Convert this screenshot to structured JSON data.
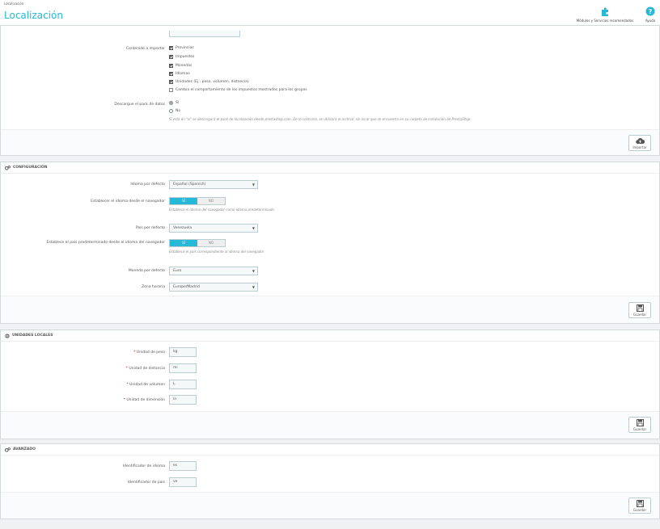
{
  "header": {
    "breadcrumb": "Localización",
    "title": "Localización",
    "modules_label": "Módulos y Servicios recomendados",
    "help_label": "Ayuda"
  },
  "import": {
    "content_label": "Contenido a importar",
    "items": [
      {
        "label": "Provincias",
        "checked": true
      },
      {
        "label": "Impuestos",
        "checked": true
      },
      {
        "label": "Monedas",
        "checked": true
      },
      {
        "label": "Idiomas",
        "checked": true
      },
      {
        "label": "Unidades (Ej.: peso, volumen, distancia)",
        "checked": true
      },
      {
        "label": "Cambia el comportamiento de los impuestos mostrados para los grupos",
        "checked": false
      }
    ],
    "download_label": "Descargue el pack de datos",
    "radio_yes": "Sí",
    "radio_no": "No",
    "help": "Si está en \"sí\" se descargará el pack de localización desde prestashop.com. De lo contrario, se utilizará el archivo, sin incar que se encuentra en su carpeta de instalación de PrestaShop.",
    "import_button": "Importar"
  },
  "config": {
    "title": "Configuración",
    "language_label": "Idioma por defecto",
    "language_value": "Español (Spanish)",
    "browser_lang_label": "Establecer el idioma desde el navegador",
    "toggle_yes": "SÍ",
    "toggle_no": "NO",
    "browser_lang_help": "Establece el idioma del navegador como idioma predeterminado",
    "country_label": "País por defecto",
    "country_value": "Venezuela",
    "browser_country_label": "Establece el país predeterminado desde el idioma del navegador",
    "browser_country_help": "Establece el país correspondiente al idioma del navegador",
    "currency_label": "Moneda por defecto",
    "currency_value": "Euro",
    "timezone_label": "Zona horaria",
    "timezone_value": "Europe/Madrid",
    "save_button": "Guardar"
  },
  "units": {
    "title": "Unidades locales",
    "weight_label": "Unidad de peso",
    "weight_value": "kg",
    "distance_label": "Unidad de distancia",
    "distance_value": "mi",
    "volume_label": "Unidad de volumen",
    "volume_value": "L",
    "dimension_label": "Unidad de dimensión",
    "dimension_value": "in",
    "save_button": "Guardar"
  },
  "advanced": {
    "title": "Avanzado",
    "lang_id_label": "Identificador de idioma",
    "lang_id_value": "es",
    "country_id_label": "Identificador de país",
    "country_id_value": "ve",
    "save_button": "Guardar"
  },
  "colors": {
    "accent": "#25b9d7",
    "text": "#555555",
    "border": "#bbcdd2"
  }
}
